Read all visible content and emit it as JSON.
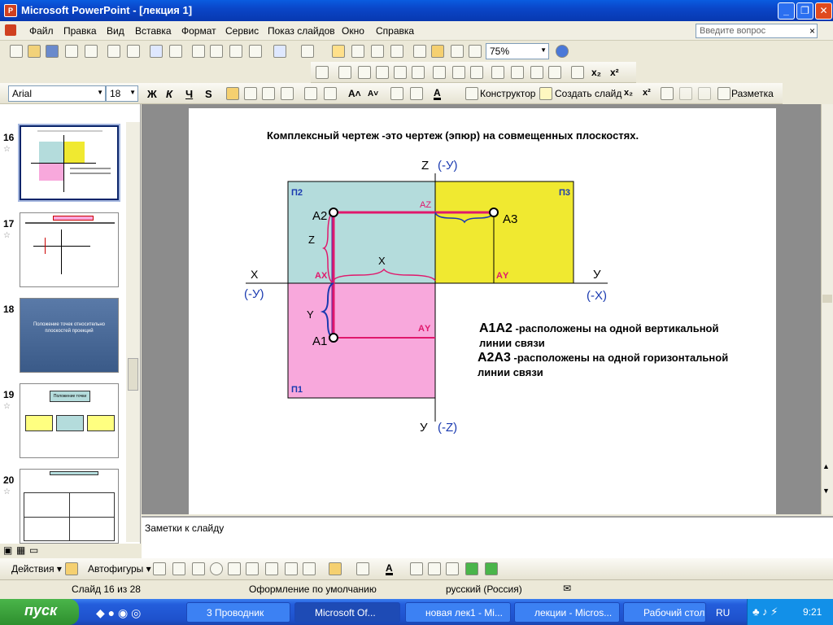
{
  "window": {
    "title": "Microsoft PowerPoint - [лекция 1]"
  },
  "menu": [
    "Файл",
    "Правка",
    "Вид",
    "Вставка",
    "Формат",
    "Сервис",
    "Показ слайдов",
    "Окно",
    "Справка"
  ],
  "help_placeholder": "Введите вопрос",
  "zoom": "75%",
  "font": {
    "name": "Arial",
    "size": "18"
  },
  "format_buttons": {
    "bold": "Ж",
    "italic": "К",
    "underline": "Ч",
    "shadow": "S"
  },
  "toolbar_labels": {
    "designer": "Конструктор",
    "new_slide": "Создать слайд",
    "layout": "Разметка"
  },
  "thumbnails": [
    {
      "num": "16",
      "starred": true
    },
    {
      "num": "17",
      "starred": true
    },
    {
      "num": "18",
      "starred": false
    },
    {
      "num": "19",
      "starred": true
    },
    {
      "num": "20",
      "starred": true
    }
  ],
  "thumb18_text": "Положение точек относительно плоскостей проекций",
  "thumb19_text": "Положение точки",
  "slide": {
    "heading": "Комплексный чертеж  -это чертеж (эпюр) на совмещенных плоскостях.",
    "axis_z": "Z",
    "axis_z_neg_y": "(-У)",
    "axis_x": "Х",
    "axis_x_neg_y": "(-У)",
    "axis_y_right": "У",
    "axis_neg_x": "(-Х)",
    "axis_y_bottom": "У",
    "axis_neg_z": "(-Z)",
    "plane_p2": "П2",
    "plane_p3": "П3",
    "plane_p1": "П1",
    "point_a2": "А2",
    "point_a3": "А3",
    "point_a1": "А1",
    "label_az": "АZ",
    "label_ax": "АX",
    "label_ay_top": "АY",
    "label_ay_bottom": "АY",
    "dim_z": "Z",
    "dim_x": "Х",
    "dim_y": "Y",
    "note1_points": "А1А2",
    "note1_text": " -расположены на одной вертикальной",
    "note1_text2": "линии связи",
    "note2_points": "А2А3",
    "note2_text": " -расположены на одной горизонтальной",
    "note2_text2": "линии связи",
    "colors": {
      "p2": "#b4dcdc",
      "p3": "#f0e930",
      "p1": "#f8a8dc",
      "line": "#e0186c",
      "label": "#e0186c",
      "axis_label": "#1a3ab0"
    }
  },
  "notes_placeholder": "Заметки к слайду",
  "drawing": {
    "actions": "Действия ▾",
    "autoshapes": "Автофигуры ▾"
  },
  "status": {
    "slide": "Слайд 16 из 28",
    "design": "Оформление по умолчанию",
    "language": "русский (Россия)"
  },
  "taskbar": {
    "start": "пуск",
    "buttons": [
      "3 Проводник",
      "Microsoft Of...",
      "новая лек1 - Mi...",
      "лекции - Micros...",
      "Рабочий стол"
    ],
    "lang": "RU",
    "clock": "9:21"
  }
}
